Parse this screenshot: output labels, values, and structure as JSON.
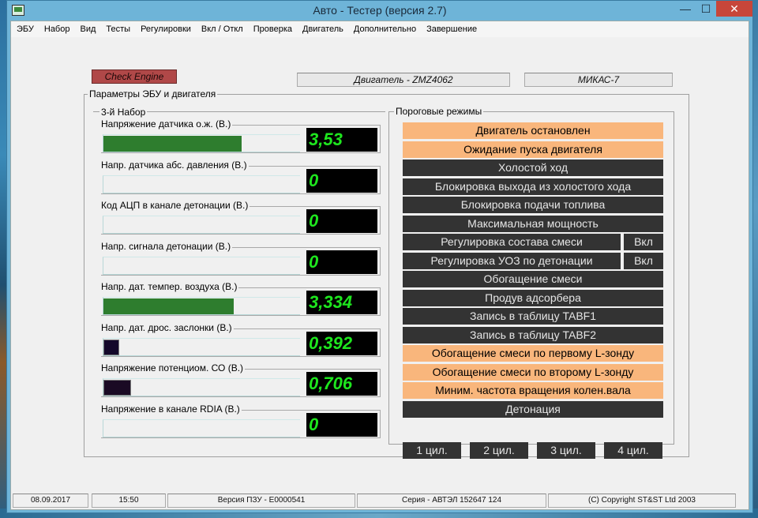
{
  "window": {
    "title": "Авто - Тестер  (версия 2.7)",
    "min_glyph": "—",
    "max_glyph": "☐",
    "close_glyph": "✕"
  },
  "menu": [
    "ЭБУ",
    "Набор",
    "Вид",
    "Тесты",
    "Регулировки",
    "Вкл / Откл",
    "Проверка",
    "Двигатель",
    "Дополнительно",
    "Завершение"
  ],
  "check_engine": "Check Engine",
  "engine_label": "Двигатель - ZMZ4062",
  "ecu_label": "МИКАС-7",
  "params_group": "Параметры ЭБУ и двигателя",
  "set_group": "3-й  Набор",
  "sensors": [
    {
      "label": "Напряжение датчика о.ж. (В.)",
      "value": "3,53",
      "fill": 0.7,
      "bar_color": "#2e7d2e"
    },
    {
      "label": "Напр. датчика абс. давления (В.)",
      "value": "0",
      "fill": 0,
      "bar_color": "#2e7d2e"
    },
    {
      "label": "Код АЦП в канале детонации (В.)",
      "value": "0",
      "fill": 0,
      "bar_color": "#2e7d2e"
    },
    {
      "label": "Напр.  сигнала   детонации (В.)",
      "value": "0",
      "fill": 0,
      "bar_color": "#2e7d2e"
    },
    {
      "label": "Напр. дат. темпер. воздуха (В.)",
      "value": "3,334",
      "fill": 0.66,
      "bar_color": "#2e7d2e"
    },
    {
      "label": "Напр. дат. дрос. заслонки (В.)",
      "value": "0,392",
      "fill": 0.08,
      "bar_color": "#14082a"
    },
    {
      "label": "Напряжение потенциом. СО (В.)",
      "value": "0,706",
      "fill": 0.14,
      "bar_color": "#1a0a24"
    },
    {
      "label": "Напряжение в канале RDIA (В.)",
      "value": "0",
      "fill": 0,
      "bar_color": "#2e7d2e"
    }
  ],
  "modes_group": "Пороговые режимы",
  "modes": [
    {
      "label": "Двигатель остановлен",
      "active": true
    },
    {
      "label": "Ожидание пуска двигателя",
      "active": true
    },
    {
      "label": "Холостой ход",
      "active": false
    },
    {
      "label": "Блокировка выхода из холостого хода",
      "active": false
    },
    {
      "label": "Блокировка подачи топлива",
      "active": false
    },
    {
      "label": "Максимальная мощность",
      "active": false
    },
    {
      "label": "Регулировка состава смеси",
      "active": false,
      "toggle": "Вкл"
    },
    {
      "label": "Регулировка УОЗ по детонации",
      "active": false,
      "toggle": "Вкл"
    },
    {
      "label": "Обогащение смеси",
      "active": false
    },
    {
      "label": "Продув адсорбера",
      "active": false
    },
    {
      "label": "Запись в таблицу TABF1",
      "active": false
    },
    {
      "label": "Запись в таблицу TABF2",
      "active": false
    },
    {
      "label": "Обогащение смеси по первому L-зонду",
      "active": true
    },
    {
      "label": "Обогащение смеси по второму L-зонду",
      "active": true
    },
    {
      "label": "Миним. частота вращения колен.вала",
      "active": true
    },
    {
      "label": "Детонация",
      "active": false
    }
  ],
  "cylinders": [
    "1 цил.",
    "2 цил.",
    "3 цил.",
    "4 цил."
  ],
  "status": {
    "date": "08.09.2017",
    "time": "15:50",
    "rom_version": "Версия ПЗУ - E0000541",
    "series": "Серия - АВТЭЛ 152647 124",
    "copyright": "(C) Copyright   ST&ST  Ltd 2003"
  },
  "colors": {
    "active_mode": "#f9b67c",
    "inactive_mode": "#333333",
    "display_text": "#1ee61e",
    "check_engine": "#b04848"
  }
}
